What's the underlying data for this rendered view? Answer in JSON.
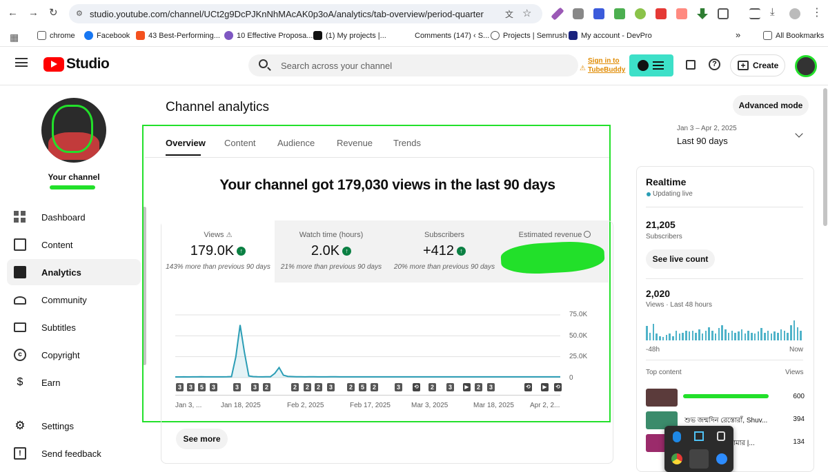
{
  "browser": {
    "url": "studio.youtube.com/channel/UCt2g9DcPJKnNhMAcAK0p3oA/analytics/tab-overview/period-quarter",
    "bookmarks": [
      "chrome",
      "Facebook",
      "43 Best-Performing...",
      "10 Effective Proposa...",
      "(1)  My projects |...",
      "Comments (147) ‹ S...",
      "Projects | Semrush",
      "My account - DevPro"
    ],
    "all_bookmarks": "All Bookmarks",
    "overflow": "»"
  },
  "header": {
    "logo_text": "Studio",
    "search_placeholder": "Search across your channel",
    "tubebuddy_line1": "Sign in to",
    "tubebuddy_line2": "TubeBuddy",
    "create_label": "Create"
  },
  "sidebar": {
    "channel_label": "Your channel",
    "items": [
      {
        "label": "Dashboard",
        "icon": "dashboard-icon"
      },
      {
        "label": "Content",
        "icon": "content-icon"
      },
      {
        "label": "Analytics",
        "icon": "analytics-icon"
      },
      {
        "label": "Community",
        "icon": "community-icon"
      },
      {
        "label": "Subtitles",
        "icon": "subtitles-icon"
      },
      {
        "label": "Copyright",
        "icon": "copyright-icon"
      },
      {
        "label": "Earn",
        "icon": "earn-icon"
      }
    ],
    "bottom_items": [
      {
        "label": "Settings",
        "icon": "gear-icon"
      },
      {
        "label": "Send feedback",
        "icon": "feedback-icon"
      }
    ]
  },
  "main": {
    "title": "Channel analytics",
    "advanced_mode": "Advanced mode",
    "date_range": "Jan 3 – Apr 2, 2025",
    "period": "Last 90 days",
    "tabs": [
      "Overview",
      "Content",
      "Audience",
      "Revenue",
      "Trends"
    ],
    "headline": "Your channel got 179,030 views in the last 90 days",
    "metrics": [
      {
        "label": "Views",
        "value": "179.0K",
        "sub": "143% more than previous 90 days"
      },
      {
        "label": "Watch time (hours)",
        "value": "2.0K",
        "sub": "21% more than previous 90 days"
      },
      {
        "label": "Subscribers",
        "value": "+412",
        "sub": "20% more than previous 90 days"
      },
      {
        "label": "Estimated revenue",
        "value": "",
        "sub": ""
      }
    ],
    "see_more": "See more",
    "markers": [
      "3",
      "3",
      "5",
      "3",
      "3",
      "3",
      "2",
      "2",
      "2",
      "2",
      "3",
      "2",
      "5",
      "2",
      "3",
      "2",
      "3",
      "2",
      "3"
    ]
  },
  "chart_data": {
    "type": "area",
    "x_tick_labels": [
      "Jan 3, ...",
      "Jan 18, 2025",
      "Feb 2, 2025",
      "Feb 17, 2025",
      "Mar 3, 2025",
      "Mar 18, 2025",
      "Apr 2, 2..."
    ],
    "y_tick_labels": [
      "75.0K",
      "50.0K",
      "25.0K",
      "0"
    ],
    "ylim": [
      0,
      75000
    ],
    "values": [
      800,
      800,
      900,
      800,
      900,
      900,
      1000,
      900,
      900,
      900,
      900,
      900,
      1000,
      1200,
      25000,
      63000,
      30000,
      2000,
      1200,
      1000,
      900,
      1000,
      1000,
      5000,
      12000,
      3000,
      1500,
      1200,
      1100,
      1000,
      900,
      1000,
      1000,
      900,
      900,
      900,
      1000,
      1000,
      900,
      900,
      900,
      900,
      900,
      900,
      900,
      900,
      900,
      900,
      900,
      900,
      900,
      900,
      900,
      900,
      900,
      900,
      900,
      900,
      900,
      900,
      900,
      900,
      900,
      900,
      900,
      900,
      900,
      900,
      900,
      900,
      900,
      900,
      900,
      900,
      900,
      900,
      900,
      900,
      900,
      900,
      900,
      900,
      900,
      900,
      900,
      900,
      900,
      900,
      900,
      900
    ],
    "color": "#2a9db5",
    "grid": true
  },
  "realtime": {
    "title": "Realtime",
    "status": "Updating live",
    "subscribers_value": "21,205",
    "subscribers_label": "Subscribers",
    "see_live_count": "See live count",
    "views_value": "2,020",
    "views_label": "Views · Last 48 hours",
    "left_label": "-48h",
    "right_label": "Now",
    "bars": [
      0.65,
      0.35,
      0.75,
      0.3,
      0.2,
      0.15,
      0.25,
      0.3,
      0.2,
      0.45,
      0.3,
      0.35,
      0.45,
      0.4,
      0.45,
      0.35,
      0.5,
      0.3,
      0.45,
      0.6,
      0.45,
      0.3,
      0.55,
      0.7,
      0.5,
      0.35,
      0.45,
      0.35,
      0.4,
      0.5,
      0.3,
      0.45,
      0.35,
      0.3,
      0.4,
      0.55,
      0.35,
      0.45,
      0.3,
      0.4,
      0.35,
      0.5,
      0.45,
      0.35,
      0.7,
      0.9,
      0.6,
      0.45
    ],
    "top_content_label": "Top content",
    "views_col": "Views",
    "top_content": [
      {
        "title": "",
        "views": "600"
      },
      {
        "title": "শুভ জন্মদিন রেস্তোরাঁ, Shuv...",
        "views": "394"
      },
      {
        "title": "এ রক্তাক্ত হৃদয় আমার |...",
        "views": "134"
      }
    ]
  },
  "colors": {
    "accent_green": "#0b8043",
    "annotation_green": "#22e02a",
    "youtube_red": "#ff0000",
    "tubebuddy_teal": "#3de0c8",
    "chart_line": "#2a9db5"
  }
}
